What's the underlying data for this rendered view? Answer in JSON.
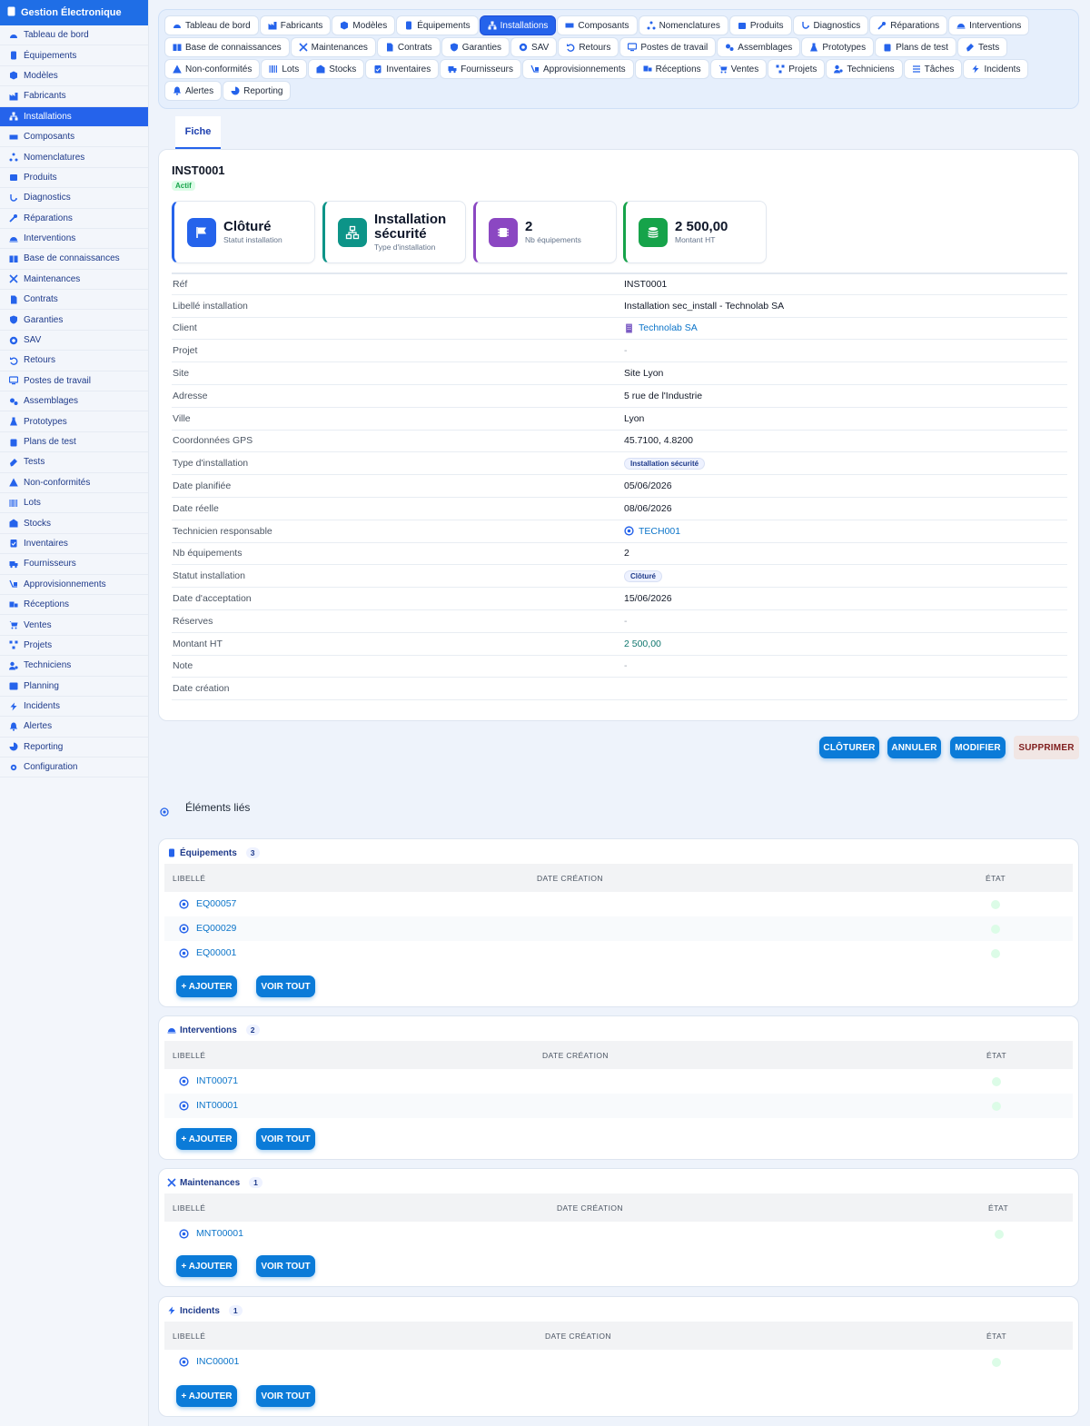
{
  "app": {
    "title": "Gestion Électronique"
  },
  "sidebar": {
    "items": [
      {
        "label": "Tableau de bord",
        "icon": "dashboard-icon"
      },
      {
        "label": "Équipements",
        "icon": "device-icon"
      },
      {
        "label": "Modèles",
        "icon": "cube-icon"
      },
      {
        "label": "Fabricants",
        "icon": "factory-icon"
      },
      {
        "label": "Installations",
        "icon": "network-icon",
        "active": true
      },
      {
        "label": "Composants",
        "icon": "memory-icon"
      },
      {
        "label": "Nomenclatures",
        "icon": "hierarchy-icon"
      },
      {
        "label": "Produits",
        "icon": "box-icon"
      },
      {
        "label": "Diagnostics",
        "icon": "stethoscope-icon"
      },
      {
        "label": "Réparations",
        "icon": "wrench-icon"
      },
      {
        "label": "Interventions",
        "icon": "helmet-icon"
      },
      {
        "label": "Base de connaissances",
        "icon": "book-icon"
      },
      {
        "label": "Maintenances",
        "icon": "tools-icon"
      },
      {
        "label": "Contrats",
        "icon": "contract-icon"
      },
      {
        "label": "Garanties",
        "icon": "shield-icon"
      },
      {
        "label": "SAV",
        "icon": "lifebuoy-icon"
      },
      {
        "label": "Retours",
        "icon": "undo-icon"
      },
      {
        "label": "Postes de travail",
        "icon": "desktop-icon"
      },
      {
        "label": "Assemblages",
        "icon": "gears-icon"
      },
      {
        "label": "Prototypes",
        "icon": "flask-icon"
      },
      {
        "label": "Plans de test",
        "icon": "clipboard-icon"
      },
      {
        "label": "Tests",
        "icon": "test-icon"
      },
      {
        "label": "Non-conformités",
        "icon": "warning-icon"
      },
      {
        "label": "Lots",
        "icon": "barcode-icon"
      },
      {
        "label": "Stocks",
        "icon": "warehouse-icon"
      },
      {
        "label": "Inventaires",
        "icon": "clipboard-check-icon"
      },
      {
        "label": "Fournisseurs",
        "icon": "truck-icon"
      },
      {
        "label": "Approvisionnements",
        "icon": "dolly-icon"
      },
      {
        "label": "Réceptions",
        "icon": "truck-ramp-icon"
      },
      {
        "label": "Ventes",
        "icon": "cart-icon"
      },
      {
        "label": "Projets",
        "icon": "diagram-icon"
      },
      {
        "label": "Techniciens",
        "icon": "user-gear-icon"
      },
      {
        "label": "Planning",
        "icon": "calendar-icon"
      },
      {
        "label": "Incidents",
        "icon": "bolt-icon"
      },
      {
        "label": "Alertes",
        "icon": "bell-icon"
      },
      {
        "label": "Reporting",
        "icon": "pie-icon"
      },
      {
        "label": "Configuration",
        "icon": "gear-icon"
      }
    ]
  },
  "top_tabs": [
    [
      "Tableau de bord",
      "Fabricants",
      "Modèles",
      "Équipements",
      "Installations",
      "Composants",
      "Nomenclatures",
      "Produits",
      "Diagnostics",
      "Réparations",
      "Interventions"
    ],
    [
      "Base de connaissances",
      "Maintenances",
      "Contrats",
      "Garanties",
      "SAV",
      "Retours",
      "Postes de travail",
      "Assemblages",
      "Prototypes",
      "Plans de test",
      "Tests"
    ],
    [
      "Non-conformités",
      "Lots",
      "Stocks",
      "Inventaires",
      "Fournisseurs",
      "Approvisionnements",
      "Réceptions",
      "Ventes",
      "Projets",
      "Techniciens",
      "Tâches",
      "Incidents"
    ],
    [
      "Alertes",
      "Reporting"
    ]
  ],
  "active_tab": "Installations",
  "fiche_tab": "Fiche",
  "record": {
    "id": "INST0001",
    "status": "Actif",
    "kpis": [
      {
        "value": "Clôturé",
        "label": "Statut installation",
        "color": "#2563eb",
        "icon": "flag-icon"
      },
      {
        "value": "Installation sécurité",
        "label": "Type d'installation",
        "color": "#0d9488",
        "icon": "network-icon"
      },
      {
        "value": "2",
        "label": "Nb équipements",
        "color": "#8b47c2",
        "icon": "chip-icon"
      },
      {
        "value": "2 500,00",
        "label": "Montant HT",
        "color": "#16a34a",
        "icon": "coins-icon"
      }
    ],
    "fields": [
      {
        "label": "Réf",
        "value": "INST0001"
      },
      {
        "label": "Libellé installation",
        "value": "Installation sec_install - Technolab SA"
      },
      {
        "label": "Client",
        "value": "Technolab SA",
        "kind": "link",
        "icon": "building-icon"
      },
      {
        "label": "Projet",
        "value": "-",
        "kind": "muted"
      },
      {
        "label": "Site",
        "value": "Site Lyon"
      },
      {
        "label": "Adresse",
        "value": "5 rue de l'Industrie"
      },
      {
        "label": "Ville",
        "value": "Lyon"
      },
      {
        "label": "Coordonnées GPS",
        "value": "45.7100, 4.8200"
      },
      {
        "label": "Type d'installation",
        "value": "Installation sécurité",
        "kind": "pill"
      },
      {
        "label": "Date planifiée",
        "value": "05/06/2026"
      },
      {
        "label": "Date réelle",
        "value": "08/06/2026"
      },
      {
        "label": "Technicien responsable",
        "value": "TECH001",
        "kind": "link",
        "icon": "cog-icon"
      },
      {
        "label": "Nb équipements",
        "value": "2"
      },
      {
        "label": "Statut installation",
        "value": "Clôturé",
        "kind": "pill"
      },
      {
        "label": "Date d'acceptation",
        "value": "15/06/2026"
      },
      {
        "label": "Réserves",
        "value": "-",
        "kind": "muted"
      },
      {
        "label": "Montant HT",
        "value": "2 500,00",
        "kind": "money"
      },
      {
        "label": "Note",
        "value": "-",
        "kind": "muted"
      },
      {
        "label": "Date création",
        "value": ""
      }
    ]
  },
  "actions": {
    "close": "CLÔTURER",
    "cancel": "ANNULER",
    "edit": "MODIFIER",
    "delete": "SUPPRIMER"
  },
  "linked": {
    "title": "Éléments liés",
    "sections": [
      {
        "name": "Équipements",
        "icon": "device-icon",
        "count": "3",
        "headers": [
          "LIBELLÉ",
          "DATE CRÉATION",
          "ÉTAT"
        ],
        "rows": [
          "EQ00057",
          "EQ00029",
          "EQ00001"
        ]
      },
      {
        "name": "Interventions",
        "icon": "helmet-icon",
        "count": "2",
        "headers": [
          "LIBELLÉ",
          "DATE CRÉATION",
          "ÉTAT"
        ],
        "rows": [
          "INT00071",
          "INT00001"
        ]
      },
      {
        "name": "Maintenances",
        "icon": "tools-icon",
        "count": "1",
        "headers": [
          "LIBELLÉ",
          "DATE CRÉATION",
          "ÉTAT"
        ],
        "rows": [
          "MNT00001"
        ]
      },
      {
        "name": "Incidents",
        "icon": "bolt-icon",
        "count": "1",
        "headers": [
          "LIBELLÉ",
          "DATE CRÉATION",
          "ÉTAT"
        ],
        "rows": [
          "INC00001"
        ]
      }
    ],
    "add_label": "+ AJOUTER",
    "see_all_label": "VOIR TOUT"
  }
}
